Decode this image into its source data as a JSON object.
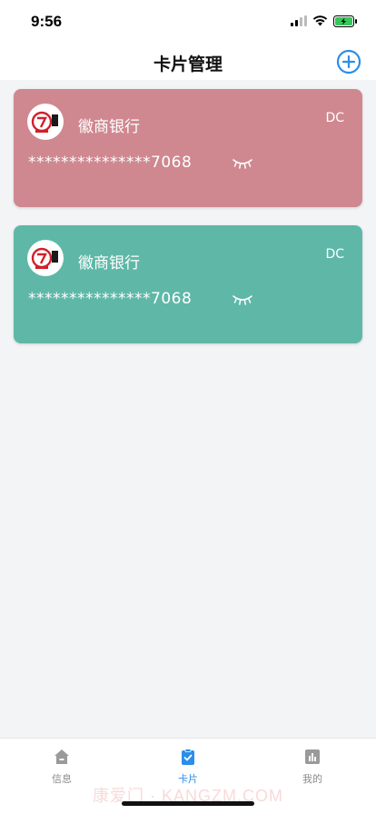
{
  "status_bar": {
    "time": "9:56"
  },
  "header": {
    "title": "卡片管理",
    "add_icon": "plus-circle-icon"
  },
  "cards": [
    {
      "bank_name": "徽商银行",
      "card_type": "DC",
      "card_number": "***************7068",
      "color": "#cf8890",
      "logo_icon": "bank-logo-icon",
      "toggle_icon": "eye-closed-icon"
    },
    {
      "bank_name": "徽商银行",
      "card_type": "DC",
      "card_number": "***************7068",
      "color": "#5fb8a7",
      "logo_icon": "bank-logo-icon",
      "toggle_icon": "eye-closed-icon"
    }
  ],
  "tab_bar": {
    "items": [
      {
        "label": "信息",
        "icon": "home-icon",
        "active": false
      },
      {
        "label": "卡片",
        "icon": "card-clipboard-icon",
        "active": true
      },
      {
        "label": "我的",
        "icon": "profile-chart-icon",
        "active": false
      }
    ],
    "active_color": "#2b8ee8",
    "inactive_color": "#8a8a8a"
  },
  "watermark": "康爱门 · KANGZM.COM"
}
